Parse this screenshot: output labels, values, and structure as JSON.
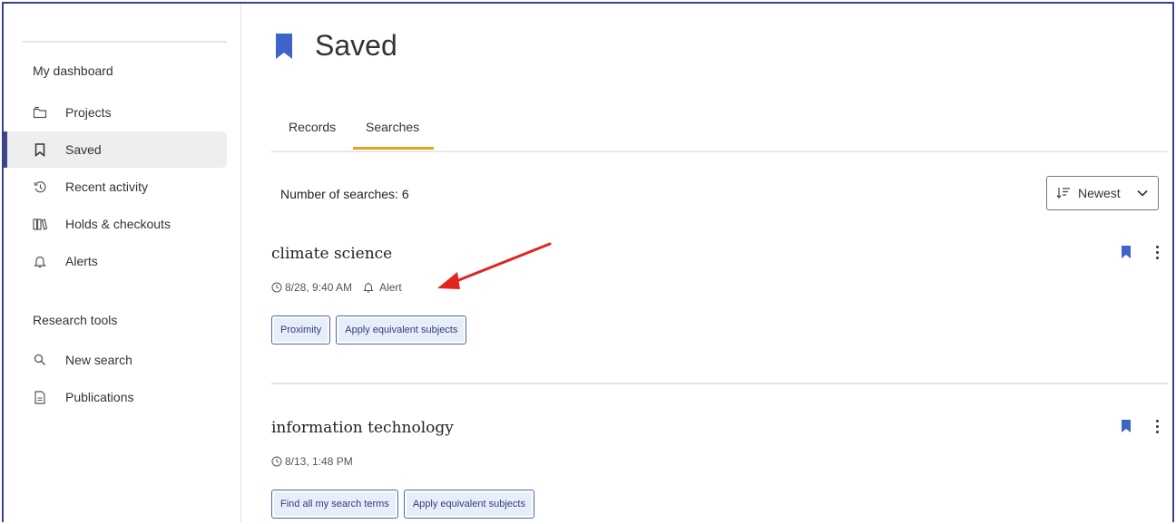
{
  "sidebar": {
    "section1_heading": "My dashboard",
    "items": [
      {
        "label": "Projects",
        "icon": "folder-icon"
      },
      {
        "label": "Saved",
        "icon": "bookmark-outline-icon",
        "active": true
      },
      {
        "label": "Recent activity",
        "icon": "history-icon"
      },
      {
        "label": "Holds & checkouts",
        "icon": "books-icon"
      },
      {
        "label": "Alerts",
        "icon": "bell-icon"
      }
    ],
    "section2_heading": "Research tools",
    "tools": [
      {
        "label": "New search",
        "icon": "search-icon"
      },
      {
        "label": "Publications",
        "icon": "document-icon"
      }
    ]
  },
  "header": {
    "title": "Saved",
    "icon": "bookmark-filled-icon"
  },
  "tabs": [
    {
      "label": "Records",
      "active": false
    },
    {
      "label": "Searches",
      "active": true
    }
  ],
  "results_bar": {
    "count_text": "Number of searches: 6",
    "sort_label": "Newest"
  },
  "searches": [
    {
      "title": "climate science",
      "timestamp": "8/28, 9:40 AM",
      "alert_label": "Alert",
      "tags": [
        "Proximity",
        "Apply equivalent subjects"
      ]
    },
    {
      "title": "information technology",
      "timestamp": "8/13, 1:48 PM",
      "tags": [
        "Find all my search terms",
        "Apply equivalent subjects"
      ]
    }
  ],
  "colors": {
    "accent_bookmark": "#3d64c6",
    "tab_underline": "#e0a32a",
    "active_sidebar_bar": "#3a4a86",
    "annotation_arrow": "#e0261f",
    "frame_border": "#3a3f8f"
  }
}
